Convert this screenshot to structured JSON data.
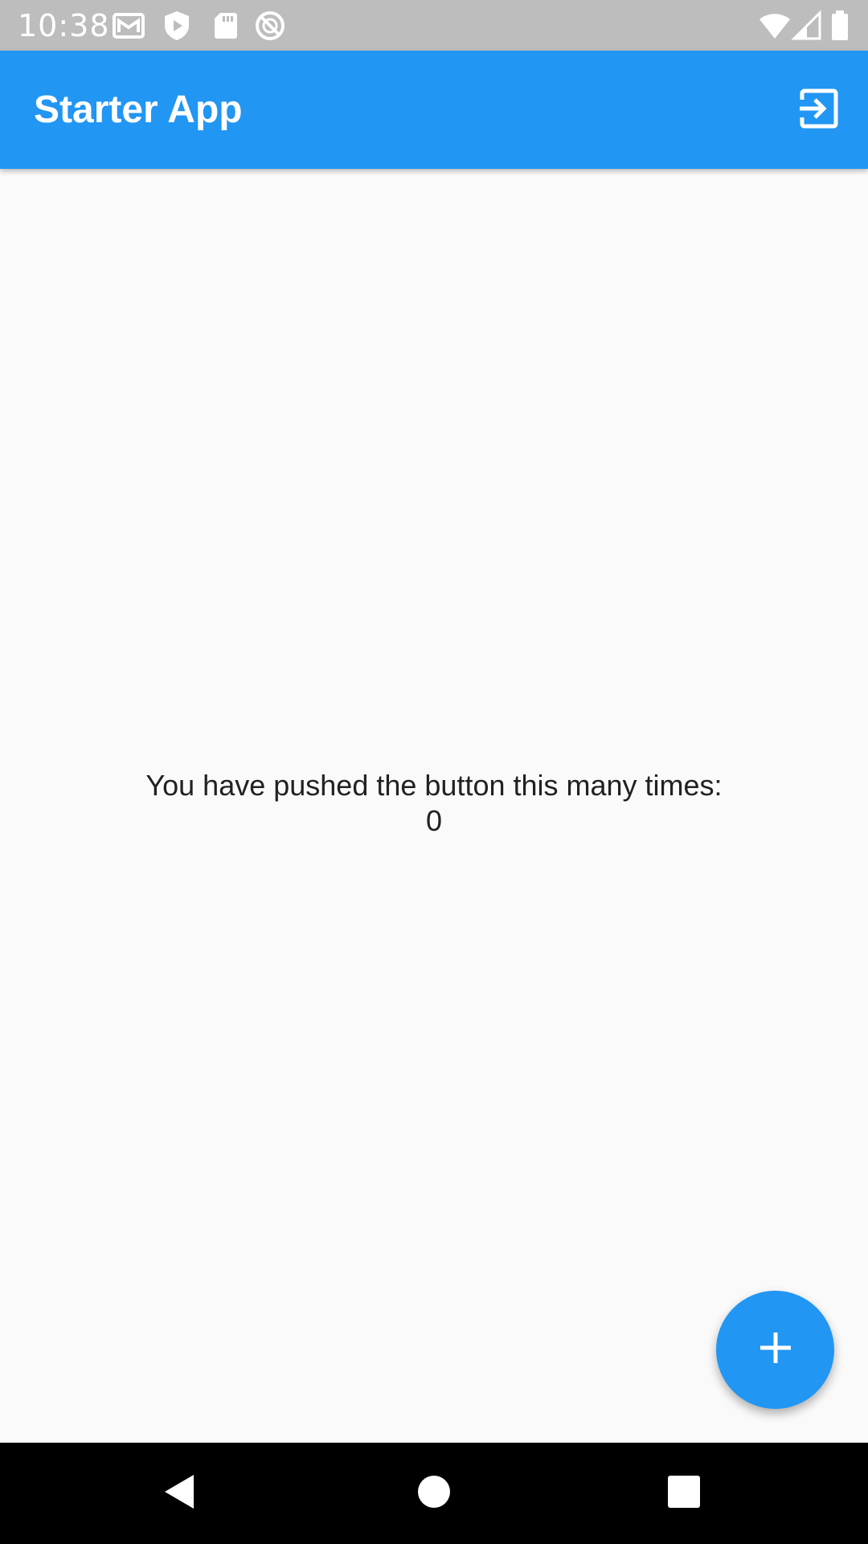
{
  "status_bar": {
    "time": "10:38",
    "left_icons": [
      "gmail-icon",
      "shield-play-icon",
      "sd-card-icon",
      "do-not-disturb-icon"
    ],
    "right_icons": [
      "wifi-icon",
      "cell-signal-icon",
      "battery-icon"
    ]
  },
  "app_bar": {
    "title": "Starter App",
    "action_icon": "exit-to-app-icon",
    "color": "#2196f3"
  },
  "main": {
    "counter_label": "You have pushed the button this many times:",
    "counter_value": "0"
  },
  "fab": {
    "icon": "add-icon",
    "color": "#2196f3"
  },
  "nav_bar": {
    "buttons": [
      "back-icon",
      "home-icon",
      "recents-icon"
    ]
  }
}
